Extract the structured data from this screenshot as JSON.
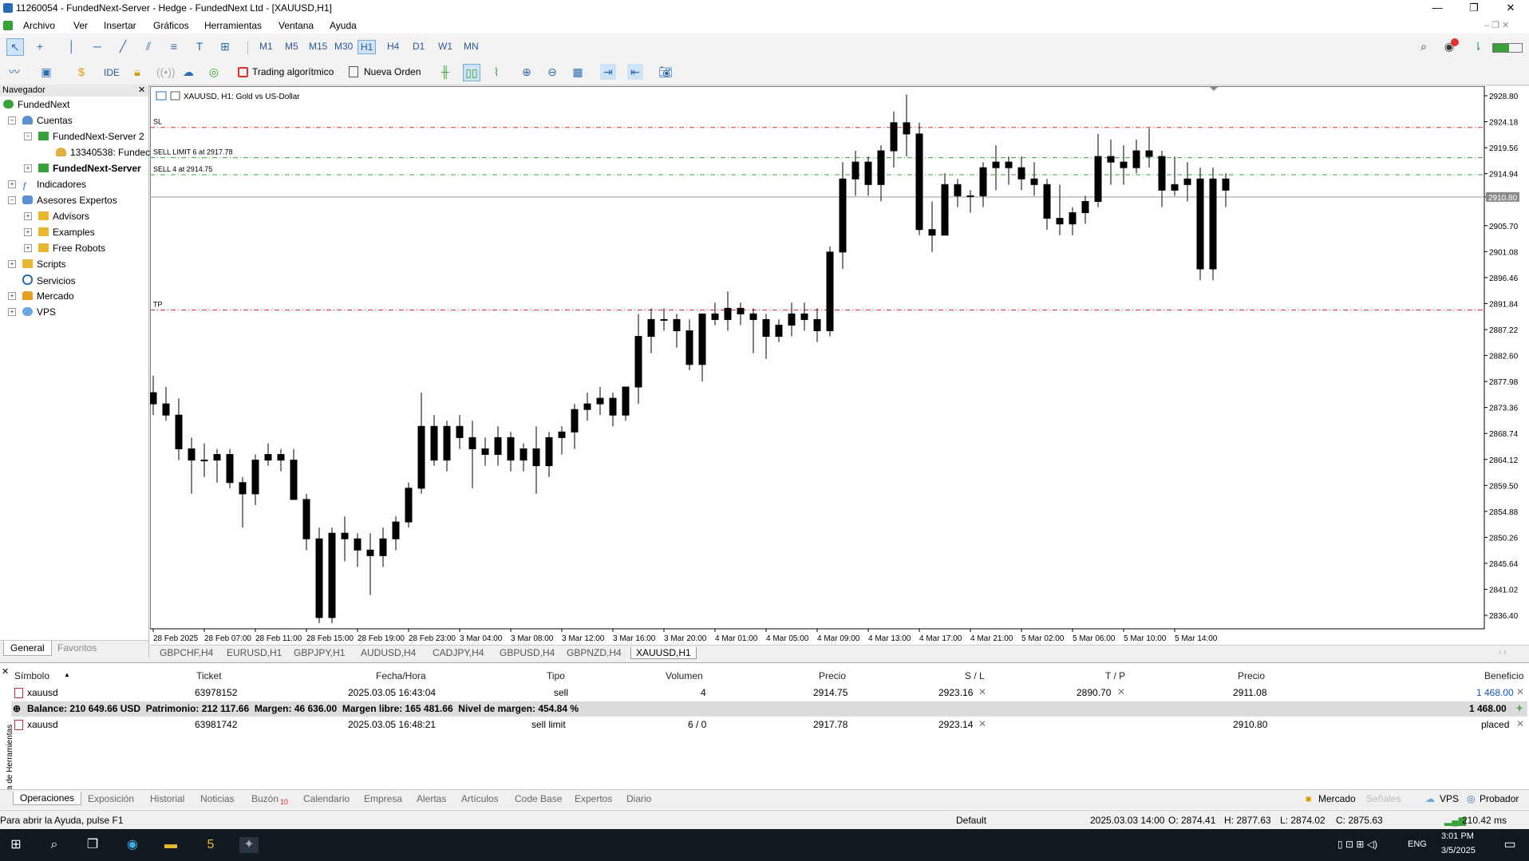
{
  "window": {
    "title": "11260054 - FundedNext-Server - Hedge - FundedNext Ltd - [XAUUSD,H1]"
  },
  "menu": [
    "Archivo",
    "Ver",
    "Insertar",
    "Gráficos",
    "Herramientas",
    "Ventana",
    "Ayuda"
  ],
  "timeframes": [
    "M1",
    "M5",
    "M15",
    "M30",
    "H1",
    "H4",
    "D1",
    "W1",
    "MN"
  ],
  "selected_timeframe": "H1",
  "toolbar2": {
    "ide": "IDE",
    "algo": "Trading algorítmico",
    "new_order": "Nueva Orden"
  },
  "navigator": {
    "title": "Navegador",
    "items": [
      {
        "label": "FundedNext",
        "level": 0
      },
      {
        "label": "Cuentas",
        "level": 1
      },
      {
        "label": "FundedNext-Server 2",
        "level": 2
      },
      {
        "label": "13340538: Fundec",
        "level": 3
      },
      {
        "label": "FundedNext-Server",
        "level": 2
      },
      {
        "label": "Indicadores",
        "level": 1
      },
      {
        "label": "Asesores Expertos",
        "level": 1
      },
      {
        "label": "Advisors",
        "level": 2
      },
      {
        "label": "Examples",
        "level": 2
      },
      {
        "label": "Free Robots",
        "level": 2
      },
      {
        "label": "Scripts",
        "level": 1
      },
      {
        "label": "Servicios",
        "level": 1
      },
      {
        "label": "Mercado",
        "level": 1
      },
      {
        "label": "VPS",
        "level": 1
      }
    ],
    "tabs": [
      "General",
      "Favoritos"
    ]
  },
  "chart": {
    "symbol_title": "XAUUSD, H1:  Gold vs US-Dollar",
    "lines": [
      {
        "label": "SL",
        "price": 2923.16,
        "color": "#e03030"
      },
      {
        "label": "SELL LIMIT 6 at 2917.78",
        "price": 2917.78,
        "color": "#3aa03a"
      },
      {
        "label": "SELL 4 at 2914.75",
        "price": 2914.75,
        "color": "#3aa03a"
      },
      {
        "label": "TP",
        "price": 2890.7,
        "color": "#e03030"
      }
    ],
    "current_price": "2910.80",
    "y_ticks": [
      "2928.80",
      "2924.18",
      "2919.56",
      "2914.94",
      "2910.80",
      "2905.70",
      "2901.08",
      "2896.46",
      "2891.84",
      "2887.22",
      "2882.60",
      "2877.98",
      "2873.36",
      "2868.74",
      "2864.12",
      "2859.50",
      "2854.88",
      "2850.26",
      "2845.64",
      "2841.02",
      "2836.40"
    ],
    "x_ticks": [
      "28 Feb 2025",
      "28 Feb 07:00",
      "28 Feb 11:00",
      "28 Feb 15:00",
      "28 Feb 19:00",
      "28 Feb 23:00",
      "3 Mar 04:00",
      "3 Mar 08:00",
      "3 Mar 12:00",
      "3 Mar 16:00",
      "3 Mar 20:00",
      "4 Mar 01:00",
      "4 Mar 05:00",
      "4 Mar 09:00",
      "4 Mar 13:00",
      "4 Mar 17:00",
      "4 Mar 21:00",
      "5 Mar 02:00",
      "5 Mar 06:00",
      "5 Mar 10:00",
      "5 Mar 14:00"
    ]
  },
  "chart_data": {
    "type": "candlestick",
    "ylim": [
      2834.0,
      2930.5
    ],
    "ohlc": [
      [
        2876,
        2879,
        2872,
        2874
      ],
      [
        2874,
        2877,
        2871,
        2872
      ],
      [
        2872,
        2875,
        2864,
        2866
      ],
      [
        2866,
        2868,
        2858,
        2864
      ],
      [
        2864,
        2867,
        2861,
        2864
      ],
      [
        2864,
        2866,
        2860,
        2865
      ],
      [
        2865,
        2866,
        2859,
        2860
      ],
      [
        2860,
        2861,
        2852,
        2858
      ],
      [
        2858,
        2865,
        2856,
        2864
      ],
      [
        2864,
        2867,
        2863,
        2865
      ],
      [
        2865,
        2866,
        2862,
        2864
      ],
      [
        2864,
        2866,
        2858,
        2857
      ],
      [
        2857,
        2858,
        2848,
        2850
      ],
      [
        2850,
        2852,
        2835,
        2836
      ],
      [
        2836,
        2852,
        2835,
        2851
      ],
      [
        2851,
        2854,
        2846,
        2850
      ],
      [
        2850,
        2851,
        2845,
        2848
      ],
      [
        2848,
        2851,
        2840,
        2847
      ],
      [
        2847,
        2852,
        2845,
        2850
      ],
      [
        2850,
        2854,
        2848,
        2853
      ],
      [
        2853,
        2860,
        2852,
        2859
      ],
      [
        2859,
        2876,
        2858,
        2870
      ],
      [
        2870,
        2872,
        2863,
        2864
      ],
      [
        2864,
        2871,
        2862,
        2870
      ],
      [
        2870,
        2872,
        2866,
        2868
      ],
      [
        2868,
        2871,
        2859,
        2866
      ],
      [
        2866,
        2868,
        2863,
        2865
      ],
      [
        2865,
        2870,
        2863,
        2868
      ],
      [
        2868,
        2869,
        2862,
        2864
      ],
      [
        2864,
        2867,
        2862,
        2866
      ],
      [
        2866,
        2870,
        2858,
        2863
      ],
      [
        2863,
        2869,
        2861,
        2868
      ],
      [
        2868,
        2870,
        2865,
        2869
      ],
      [
        2869,
        2874,
        2866,
        2873
      ],
      [
        2873,
        2876,
        2871,
        2874
      ],
      [
        2874,
        2877,
        2872,
        2875
      ],
      [
        2875,
        2876,
        2870,
        2872
      ],
      [
        2872,
        2877,
        2871,
        2877
      ],
      [
        2877,
        2890,
        2874,
        2886
      ],
      [
        2886,
        2891,
        2883,
        2889
      ],
      [
        2889,
        2891,
        2887,
        2889
      ],
      [
        2889,
        2890,
        2884,
        2887
      ],
      [
        2887,
        2889,
        2880,
        2881
      ],
      [
        2881,
        2890,
        2878,
        2890
      ],
      [
        2890,
        2892,
        2888,
        2889
      ],
      [
        2889,
        2894,
        2887,
        2891
      ],
      [
        2891,
        2892,
        2888,
        2890
      ],
      [
        2890,
        2891,
        2883,
        2889
      ],
      [
        2889,
        2890,
        2882,
        2886
      ],
      [
        2886,
        2889,
        2885,
        2888
      ],
      [
        2888,
        2892,
        2886,
        2890
      ],
      [
        2890,
        2892,
        2887,
        2889
      ],
      [
        2889,
        2891,
        2885,
        2887
      ],
      [
        2887,
        2902,
        2886,
        2901
      ],
      [
        2901,
        2917,
        2898,
        2914
      ],
      [
        2914,
        2919,
        2911,
        2917
      ],
      [
        2917,
        2918,
        2911,
        2913
      ],
      [
        2913,
        2920,
        2910,
        2919
      ],
      [
        2919,
        2926,
        2916,
        2924
      ],
      [
        2924,
        2929,
        2918,
        2922
      ],
      [
        2922,
        2924,
        2904,
        2905
      ],
      [
        2905,
        2910,
        2901,
        2904
      ],
      [
        2904,
        2915,
        2904,
        2913
      ],
      [
        2913,
        2914,
        2909,
        2911
      ],
      [
        2911,
        2912,
        2908,
        2911
      ],
      [
        2911,
        2917,
        2909,
        2916
      ],
      [
        2916,
        2920,
        2912,
        2917
      ],
      [
        2917,
        2918,
        2913,
        2916
      ],
      [
        2916,
        2918,
        2912,
        2914
      ],
      [
        2914,
        2917,
        2911,
        2913
      ],
      [
        2913,
        2914,
        2905,
        2907
      ],
      [
        2907,
        2913,
        2904,
        2906
      ],
      [
        2906,
        2909,
        2904,
        2908
      ],
      [
        2908,
        2911,
        2906,
        2910
      ],
      [
        2910,
        2922,
        2909,
        2918
      ],
      [
        2918,
        2921,
        2913,
        2917
      ],
      [
        2917,
        2920,
        2913,
        2916
      ],
      [
        2916,
        2921,
        2915,
        2919
      ],
      [
        2919,
        2923,
        2916,
        2918
      ],
      [
        2918,
        2919,
        2909,
        2912
      ],
      [
        2912,
        2918,
        2911,
        2913
      ],
      [
        2913,
        2917,
        2910,
        2914
      ],
      [
        2914,
        2916,
        2896,
        2898
      ],
      [
        2898,
        2916,
        2896,
        2914
      ],
      [
        2914,
        2915,
        2909,
        2912
      ]
    ]
  },
  "chart_tabs": [
    "GBPCHF,H4",
    "EURUSD,H1",
    "GBPJPY,H1",
    "AUDUSD,H4",
    "CADJPY,H4",
    "GBPUSD,H4",
    "GBPNZD,H4",
    "XAUUSD,H1"
  ],
  "trade": {
    "columns": [
      "Símbolo",
      "Ticket",
      "Fecha/Hora",
      "Tipo",
      "Volumen",
      "Precio",
      "S / L",
      "T / P",
      "Precio",
      "Beneficio"
    ],
    "rows": [
      {
        "symbol": "xauusd",
        "ticket": "63978152",
        "time": "2025.03.05 16:43:04",
        "type": "sell",
        "volume": "4",
        "price": "2914.75",
        "sl": "2923.16",
        "tp": "2890.70",
        "cur": "2911.08",
        "profit": "1 468.00"
      },
      {
        "symbol": "xauusd",
        "ticket": "63981742",
        "time": "2025.03.05 16:48:21",
        "type": "sell limit",
        "volume": "6 / 0",
        "price": "2917.78",
        "sl": "2923.14",
        "tp": "",
        "cur": "2910.80",
        "profit": "placed"
      }
    ],
    "balance_line": "Balance: 210 649.66 USD  Patrimonio: 212 117.66  Margen: 46 636.00  Margen libre: 165 481.66  Nivel de margen: 454.84 %",
    "balance_profit": "1 468.00",
    "side_label": "Caja de Herramientas"
  },
  "bottom_tabs": [
    "Operaciones",
    "Exposición",
    "Historial",
    "Noticias",
    "Buzón",
    "Calendario",
    "Empresa",
    "Alertas",
    "Artículos",
    "Code Base",
    "Expertos",
    "Diario"
  ],
  "mailbox_badge": "10",
  "bottom_right": [
    "Mercado",
    "Señales",
    "VPS",
    "Probador"
  ],
  "status": {
    "help": "Para abrir la Ayuda, pulse F1",
    "profile": "Default",
    "time": "2025.03.03 14:00",
    "o": "O: 2874.41",
    "h": "H: 2877.63",
    "l": "L: 2874.02",
    "c": "C: 2875.63",
    "ping": "210.42 ms"
  },
  "taskbar": {
    "time": "3:01 PM",
    "date": "3/5/2025",
    "lang": "ENG"
  },
  "colors": {
    "accent": "#2a6cb3",
    "profit": "#1a56c9",
    "sl_tp": "#e03030",
    "order": "#3aa03a"
  }
}
